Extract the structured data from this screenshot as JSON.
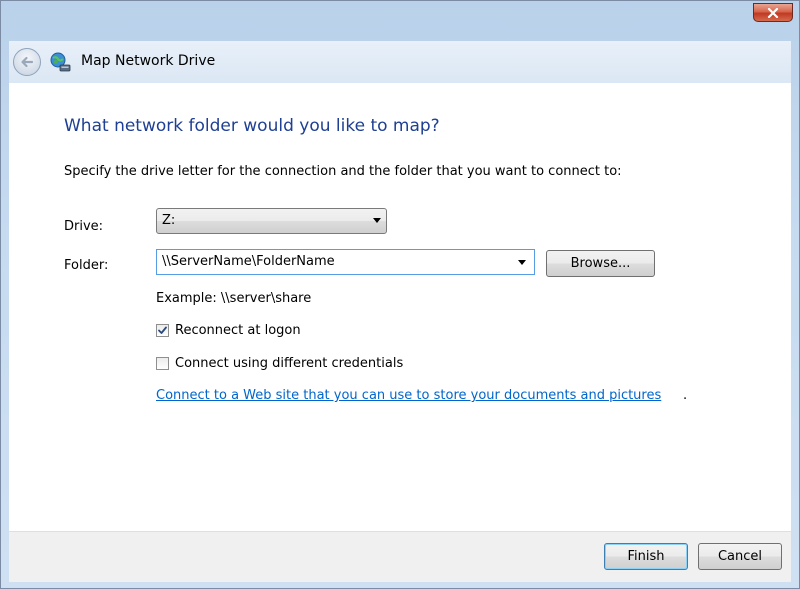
{
  "window": {
    "title": "Map Network Drive"
  },
  "page": {
    "heading": "What network folder would you like to map?",
    "instructions": "Specify the drive letter for the connection and the folder that you want to connect to:"
  },
  "drive": {
    "label": "Drive:",
    "value": "Z:"
  },
  "folder": {
    "label": "Folder:",
    "value": "\\\\ServerName\\FolderName",
    "browse_label": "Browse..."
  },
  "example": "Example: \\\\server\\share",
  "options": {
    "reconnect_label": "Reconnect at logon",
    "reconnect_checked": true,
    "credentials_label": "Connect using different credentials",
    "credentials_checked": false
  },
  "link": {
    "text": "Connect to a Web site that you can use to store your documents and pictures",
    "trailing": "."
  },
  "footer": {
    "finish_label": "Finish",
    "cancel_label": "Cancel"
  },
  "icons": {
    "close": "close-icon",
    "back": "back-arrow-icon",
    "app": "network-drive-icon",
    "checkmark": "checkmark-icon",
    "dropdown": "chevron-down-icon"
  },
  "colors": {
    "heading": "#1e3f93",
    "link": "#0066cc",
    "close": "#c13a22"
  }
}
